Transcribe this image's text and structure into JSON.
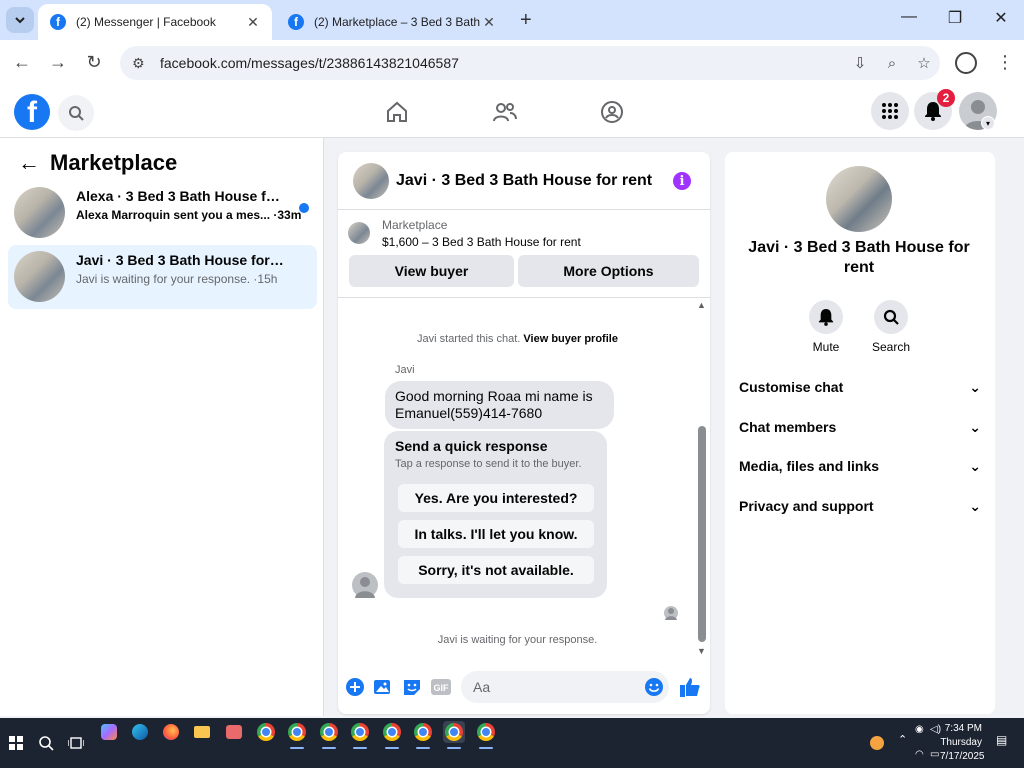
{
  "browser": {
    "tabs": [
      {
        "title": "(2) Messenger | Facebook",
        "active": true
      },
      {
        "title": "(2) Marketplace – 3 Bed 3 Bath",
        "active": false
      }
    ],
    "url": "facebook.com/messages/t/23886143821046587"
  },
  "facebook": {
    "notification_count": "2"
  },
  "left_panel": {
    "title": "Marketplace",
    "conversations": [
      {
        "name": "Alexa · 3 Bed 3 Bath House for r...",
        "snippet": "Alexa Marroquin sent you a mes... ·33m",
        "unread": true
      },
      {
        "name": "Javi · 3 Bed 3 Bath House for rent",
        "snippet": "Javi is waiting for your response. ·15h",
        "unread": false,
        "selected": true
      }
    ]
  },
  "chat": {
    "title": "Javi · 3 Bed 3 Bath House for rent",
    "marketplace_label": "Marketplace",
    "listing": "$1,600 – 3 Bed 3 Bath House for rent",
    "view_buyer": "View buyer",
    "more_options": "More Options",
    "started_text": "Javi started this chat.",
    "view_profile": "View buyer profile",
    "sender": "Javi",
    "message": "Good morning Roaa mi name is Emanuel(559)414-7680",
    "quick_title": "Send a quick response",
    "quick_sub": "Tap a response to send it to the buyer.",
    "quick_options": [
      "Yes. Are you interested?",
      "In talks. I'll let you know.",
      "Sorry, it's not available."
    ],
    "waiting": "Javi is waiting for your response.",
    "input_placeholder": "Aa"
  },
  "right_panel": {
    "name": "Javi · 3 Bed 3 Bath House for rent",
    "actions": [
      "Mute",
      "Search"
    ],
    "sections": [
      "Customise chat",
      "Chat members",
      "Media, files and links",
      "Privacy and support"
    ]
  },
  "taskbar": {
    "time": "7:34 PM",
    "day": "Thursday",
    "date": "7/17/2025"
  },
  "colors": {
    "brand": "#1877f2",
    "selected_row": "#e7f3ff",
    "badge": "#e41e3f",
    "info": "#a033ff"
  }
}
